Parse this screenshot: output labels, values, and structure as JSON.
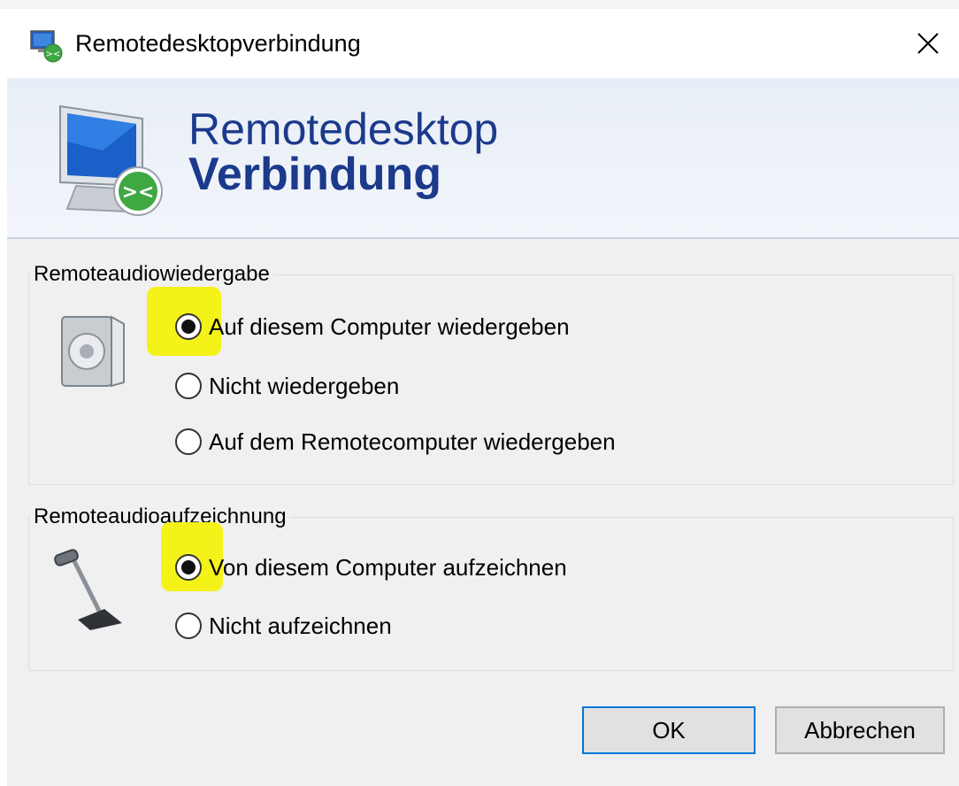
{
  "window": {
    "title": "Remotedesktopverbindung",
    "close_glyph": "×"
  },
  "banner": {
    "line1": "Remotedesktop",
    "line2": "Verbindung"
  },
  "playback": {
    "legend": "Remoteaudiowiedergabe",
    "options": [
      {
        "label": "Auf diesem Computer wiedergeben",
        "selected": true
      },
      {
        "label": "Nicht wiedergeben",
        "selected": false
      },
      {
        "label": "Auf dem Remotecomputer wiedergeben",
        "selected": false
      }
    ]
  },
  "recording": {
    "legend": "Remoteaudioaufzeichnung",
    "options": [
      {
        "label": "Von diesem Computer aufzeichnen",
        "selected": true
      },
      {
        "label": "Nicht aufzeichnen",
        "selected": false
      }
    ]
  },
  "buttons": {
    "ok": "OK",
    "cancel": "Abbrechen"
  },
  "colors": {
    "banner_text": "#1c3a8c",
    "highlight": "#f5f21a",
    "default_button_border": "#0078d7"
  }
}
